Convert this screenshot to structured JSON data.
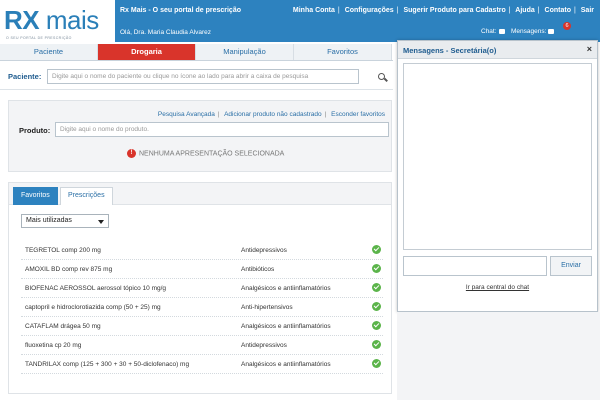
{
  "brand": {
    "logo_a": "RX",
    "logo_b": " mais",
    "tagline": "O SEU PORTAL DE PRESCRIÇÃO"
  },
  "header": {
    "title": "Rx Mais - O seu portal de prescrição",
    "greeting": "Olá, Dra. Maria Claudia Alvarez",
    "nav": [
      "Minha Conta",
      "Configurações",
      "Sugerir Produto para Cadastro",
      "Ajuda",
      "Contato",
      "Sair"
    ],
    "chat_label": "Chat:",
    "messages_label": "Mensagens:",
    "messages_count": "6"
  },
  "tabs": [
    "Paciente",
    "Drogaria",
    "Manipulação",
    "Favoritos"
  ],
  "active_tab": 1,
  "patient": {
    "label": "Paciente:",
    "placeholder": "Digite aqui o nome do paciente ou clique no ícone ao lado para abrir a caixa de pesquisa"
  },
  "product": {
    "links": [
      "Pesquisa Avançada",
      "Adicionar produto não cadastrado",
      "Esconder favoritos"
    ],
    "label": "Produto:",
    "placeholder": "Digite aqui o nome do produto.",
    "warning": "NENHUMA APRESENTAÇÃO SELECIONADA"
  },
  "lists": {
    "tabs": [
      "Favoritos",
      "Prescrições"
    ],
    "filter": "Mais utilizadas",
    "rows": [
      {
        "name": "TEGRETOL comp 200 mg",
        "cls": "Antidepressivos"
      },
      {
        "name": "AMOXIL BD comp rev 875 mg",
        "cls": "Antibióticos"
      },
      {
        "name": "BIOFENAC AEROSSOL aerossol tópico 10 mg/g",
        "cls": "Analgésicos e antiinflamatórios"
      },
      {
        "name": "captopril e hidroclorotiazida comp (50 + 25) mg",
        "cls": "Anti-hipertensivos"
      },
      {
        "name": "CATAFLAM drágea 50 mg",
        "cls": "Analgésicos e antiinflamatórios"
      },
      {
        "name": "fluoxetina cp 20 mg",
        "cls": "Antidepressivos"
      },
      {
        "name": "TANDRILAX comp (125 + 300 + 30 + 50-diclofenaco) mg",
        "cls": "Analgésicos e antiinflamatórios"
      }
    ]
  },
  "chat": {
    "title": "Mensagens - Secretária(o)",
    "close": "×",
    "send": "Enviar",
    "central_link": "Ir para central do chat"
  },
  "colors": {
    "accent": "#2d82bf",
    "active_tab": "#d9342b",
    "ok": "#5bb44a"
  }
}
